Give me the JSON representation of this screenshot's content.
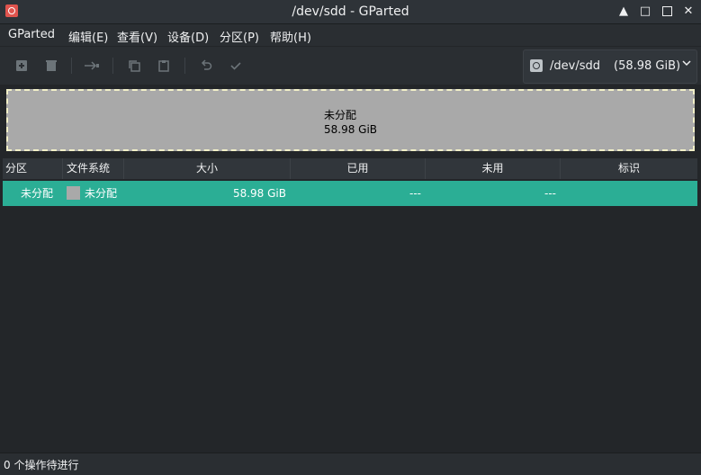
{
  "window": {
    "title": "/dev/sdd - GParted",
    "minimize_label": "▲",
    "maximize_label": "□",
    "close_label": "✕"
  },
  "menu": [
    "GParted",
    "编辑(E)",
    "查看(V)",
    "设备(D)",
    "分区(P)",
    "帮助(H)"
  ],
  "toolbar": {
    "icons": [
      "new-partition-icon",
      "delete-partition-icon",
      "resize-move-icon",
      "copy-icon",
      "paste-icon",
      "undo-icon",
      "apply-icon"
    ]
  },
  "device": {
    "name": "/dev/sdd",
    "size": "(58.98 GiB)"
  },
  "disk_map": {
    "partition_name": "未分配",
    "partition_size": "58.98 GiB",
    "fill_color": "#a9a9a9",
    "border_color": "#f2f0c8"
  },
  "table": {
    "headers": [
      "分区",
      "文件系统",
      "大小",
      "已用",
      "未用",
      "标识"
    ],
    "rows": [
      {
        "partition": "未分配",
        "filesystem": "未分配",
        "size": "58.98 GiB",
        "used": "---",
        "unused": "---",
        "flags": ""
      }
    ],
    "selected_color": "#2bae95"
  },
  "status": {
    "text": "0 个操作待进行"
  }
}
